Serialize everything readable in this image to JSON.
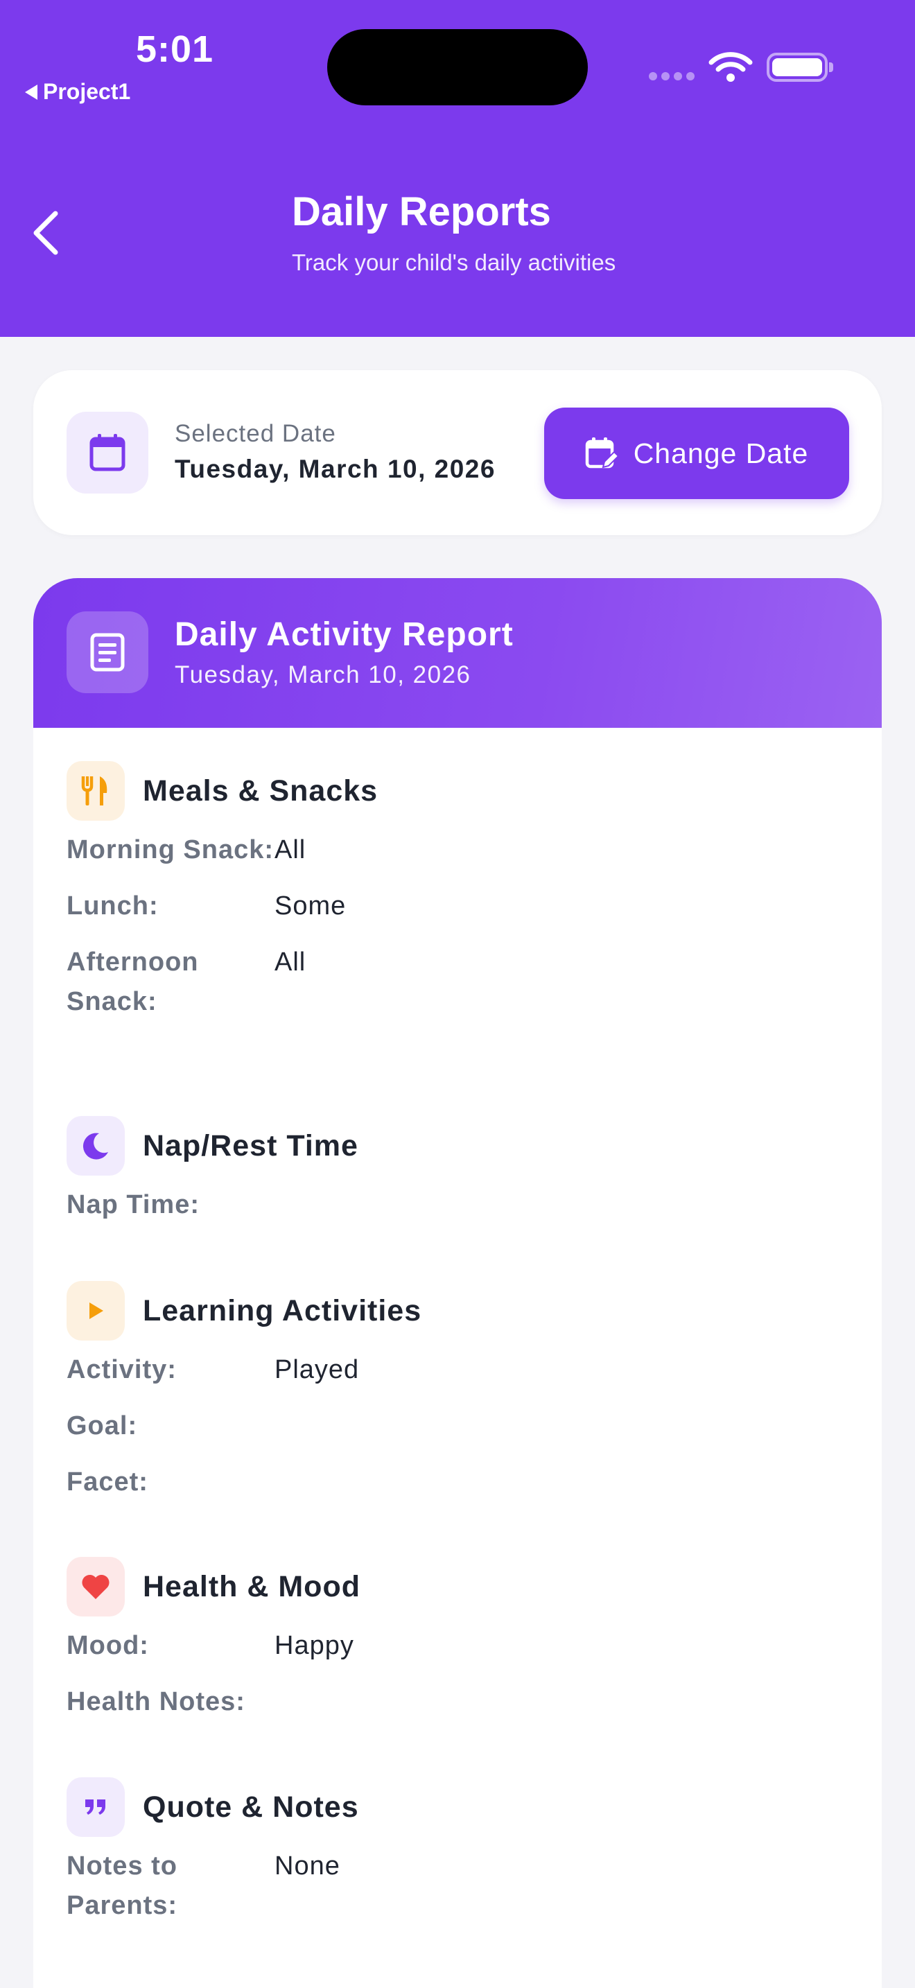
{
  "status_bar": {
    "time": "5:01",
    "back_app": "Project1"
  },
  "header": {
    "title": "Daily Reports",
    "subtitle": "Track your child's daily activities"
  },
  "date_card": {
    "label": "Selected Date",
    "value": "Tuesday, March 10, 2026",
    "button_label": "Change Date"
  },
  "report": {
    "title": "Daily Activity Report",
    "date": "Tuesday, March 10, 2026",
    "sections": [
      {
        "title": "Meals & Snacks",
        "icon": "utensils-icon",
        "rows": [
          {
            "key": "Morning Snack:",
            "value": "All"
          },
          {
            "key": "Lunch:",
            "value": "Some"
          },
          {
            "key": "Afternoon Snack:",
            "value": "All"
          }
        ]
      },
      {
        "title": "Nap/Rest Time",
        "icon": "moon-icon",
        "rows": [
          {
            "key": "Nap Time:",
            "value": ""
          }
        ]
      },
      {
        "title": "Learning Activities",
        "icon": "play-icon",
        "rows": [
          {
            "key": "Activity:",
            "value": "Played"
          },
          {
            "key": "Goal:",
            "value": ""
          },
          {
            "key": "Facet:",
            "value": ""
          }
        ]
      },
      {
        "title": "Health & Mood",
        "icon": "heart-icon",
        "rows": [
          {
            "key": "Mood:",
            "value": "Happy"
          },
          {
            "key": "Health Notes:",
            "value": ""
          }
        ]
      },
      {
        "title": "Quote & Notes",
        "icon": "quote-icon",
        "rows": [
          {
            "key": "Notes to Parents:",
            "value": "None"
          }
        ]
      }
    ]
  },
  "colors": {
    "primary": "#7c3aed",
    "meals_icon": "#f59e0b",
    "nap_icon": "#7c3aed",
    "learning_icon": "#f59e0b",
    "health_icon": "#ef4444",
    "notes_icon": "#7c3aed"
  }
}
